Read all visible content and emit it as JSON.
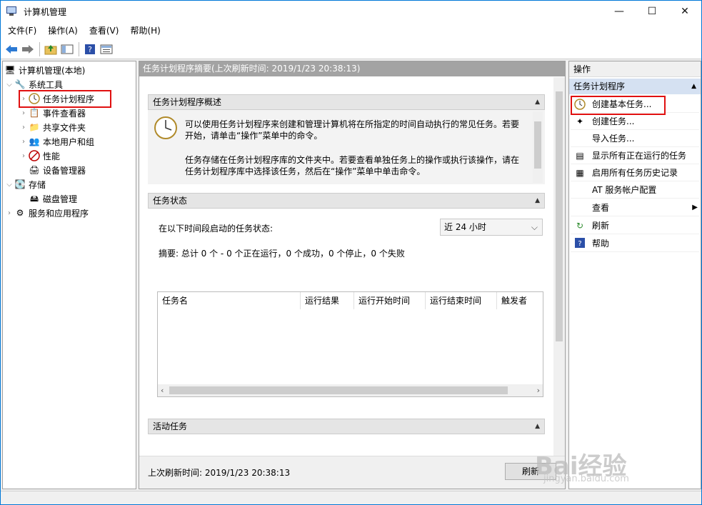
{
  "window": {
    "title": "计算机管理"
  },
  "caption_buttons": {
    "minimize": "—",
    "maximize": "☐",
    "close": "✕"
  },
  "menubar": [
    "文件(F)",
    "操作(A)",
    "查看(V)",
    "帮助(H)"
  ],
  "toolbar": {
    "icons": [
      "back-arrow-icon",
      "forward-arrow-icon",
      "up-folder-icon",
      "show-hide-tree-icon",
      "help-icon",
      "properties-icon"
    ]
  },
  "tree": {
    "root": "计算机管理(本地)",
    "system_tools": "系统工具",
    "task_scheduler": "任务计划程序",
    "event_viewer": "事件查看器",
    "shared_folders": "共享文件夹",
    "local_users": "本地用户和组",
    "performance": "性能",
    "device_manager": "设备管理器",
    "storage": "存储",
    "disk_mgmt": "磁盘管理",
    "services_apps": "服务和应用程序"
  },
  "center": {
    "header": "任务计划程序摘要(上次刷新时间: 2019/1/23 20:38:13)",
    "overview_title": "任务计划程序概述",
    "overview_p1_l1": "可以使用任务计划程序来创建和管理计算机将在所指定的时间自动执行的常见任务。若要",
    "overview_p1_l2": "开始，请单击“操作”菜单中的命令。",
    "overview_p2_l1": "任务存储在任务计划程序库的文件夹中。若要查看单独任务上的操作或执行该操作，请在",
    "overview_p2_l2": "任务计划程序库中选择该任务，然后在“操作”菜单中单击命令。",
    "status_title": "任务状态",
    "status_label": "在以下时间段启动的任务状态:",
    "period": "近 24 小时",
    "summary": "摘要: 总计 0 个 - 0 个正在运行，0 个成功，0 个停止，0 个失败",
    "columns": [
      "任务名",
      "运行结果",
      "运行开始时间",
      "运行结束时间",
      "触发者"
    ],
    "active_title": "活动任务",
    "footer": "上次刷新时间: 2019/1/23 20:38:13",
    "refresh": "刷新"
  },
  "actions": {
    "header": "操作",
    "section": "任务计划程序",
    "items": [
      "创建基本任务...",
      "创建任务...",
      "导入任务...",
      "显示所有正在运行的任务",
      "启用所有任务历史记录",
      "AT 服务帐户配置",
      "查看",
      "刷新",
      "帮助"
    ]
  },
  "watermark": {
    "logo": "Bai经验",
    "url": "jingyan.baidu.com"
  },
  "colors": {
    "highlight": "#e01010",
    "accent": "#0078d7",
    "section_selected": "#d5e1f2"
  }
}
